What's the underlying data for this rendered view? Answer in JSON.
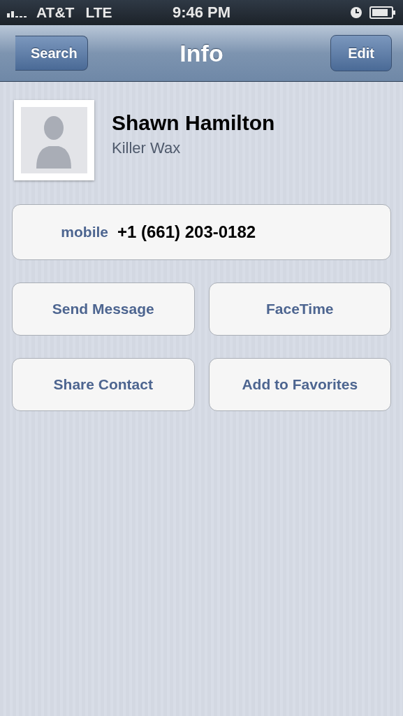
{
  "status_bar": {
    "carrier": "AT&T",
    "network": "LTE",
    "time": "9:46 PM"
  },
  "nav_bar": {
    "back_button": "Search",
    "title": "Info",
    "edit_button": "Edit"
  },
  "contact": {
    "name": "Shawn Hamilton",
    "company": "Killer Wax"
  },
  "phone": {
    "label": "mobile",
    "number": "+1 (661) 203-0182"
  },
  "actions": [
    [
      "Send Message",
      "FaceTime"
    ],
    [
      "Share Contact",
      "Add to Favorites"
    ]
  ]
}
